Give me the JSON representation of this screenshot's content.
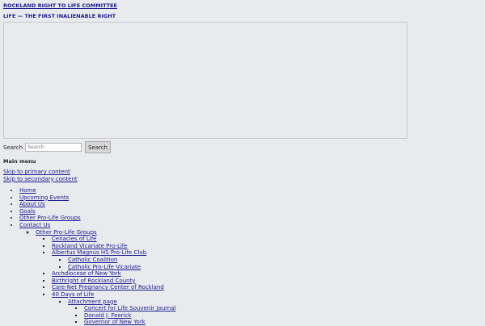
{
  "site": {
    "title": "ROCKLAND RIGHT TO LIFE COMMITTEE",
    "description": "LIFE — THE FIRST INALIENABLE RIGHT"
  },
  "search": {
    "label": "Search",
    "placeholder": "Search",
    "button": "Search"
  },
  "menu": {
    "heading": "Main menu",
    "skip_primary": "Skip to primary content",
    "skip_secondary": "Skip to secondary content",
    "items": [
      "Home",
      "Upcoming Events",
      "About Us",
      "Goals",
      "Other Pro-Life Groups",
      "Contact Us"
    ],
    "contact_sub": {
      "label": "Other Pro-Life Groups",
      "items": [
        "Cenacles of Life",
        "Rockland Vicariate Pro-Life",
        "Albertus Magnus HS Pro-Life Club",
        "Archdiocese of New York",
        "Birthright of Rockland County",
        "Care-Net Pregnancy Center of Rockland",
        "40 Days of Life"
      ],
      "albertus_sub": [
        "Catholic Coalition",
        "Catholic Pro-Life Vicariate"
      ],
      "forty_days_sub": {
        "label": "Attachment page",
        "items": [
          "Concert for Life Souvenir Journal",
          "Donald J. Feerick",
          "Governor of New York"
        ]
      }
    }
  }
}
